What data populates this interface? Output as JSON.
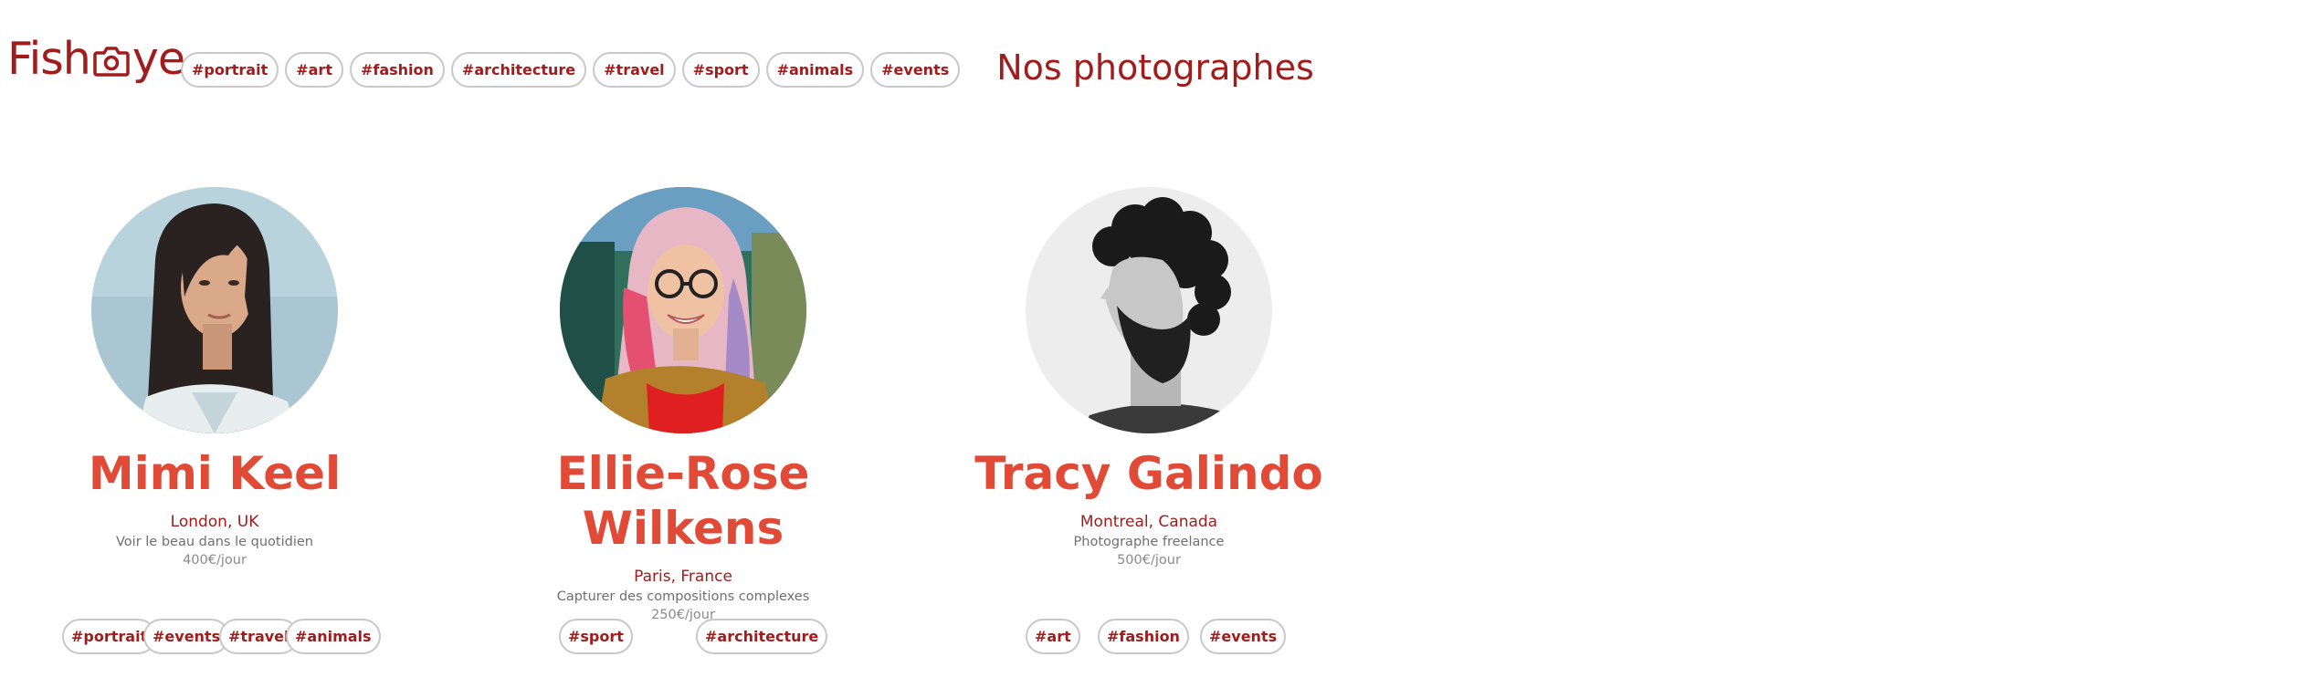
{
  "logo": {
    "text_before": "Fish",
    "text_after": "ye"
  },
  "nav": {
    "tags": [
      "#portrait",
      "#art",
      "#fashion",
      "#architecture",
      "#travel",
      "#sport",
      "#animals",
      "#events"
    ]
  },
  "page_title": "Nos photographes",
  "colors": {
    "brand_dark": "#a11c1c",
    "brand_accent": "#e04a36",
    "tag_border": "#c8c8c8",
    "muted_text": "#6f6f6f"
  },
  "photographers": [
    {
      "name": "Mimi Keel",
      "location": "London, UK",
      "tagline": "Voir le beau dans le quotidien",
      "price": "400€/jour",
      "tags": [
        "#portrait",
        "#events",
        "#travel",
        "#animals"
      ]
    },
    {
      "name": "Ellie-Rose Wilkens",
      "location": "Paris, France",
      "tagline": "Capturer des compositions complexes",
      "price": "250€/jour",
      "tags": [
        "#sport",
        "#architecture"
      ]
    },
    {
      "name": "Tracy Galindo",
      "location": "Montreal, Canada",
      "tagline": "Photographe freelance",
      "price": "500€/jour",
      "tags": [
        "#art",
        "#fashion",
        "#events"
      ]
    }
  ]
}
